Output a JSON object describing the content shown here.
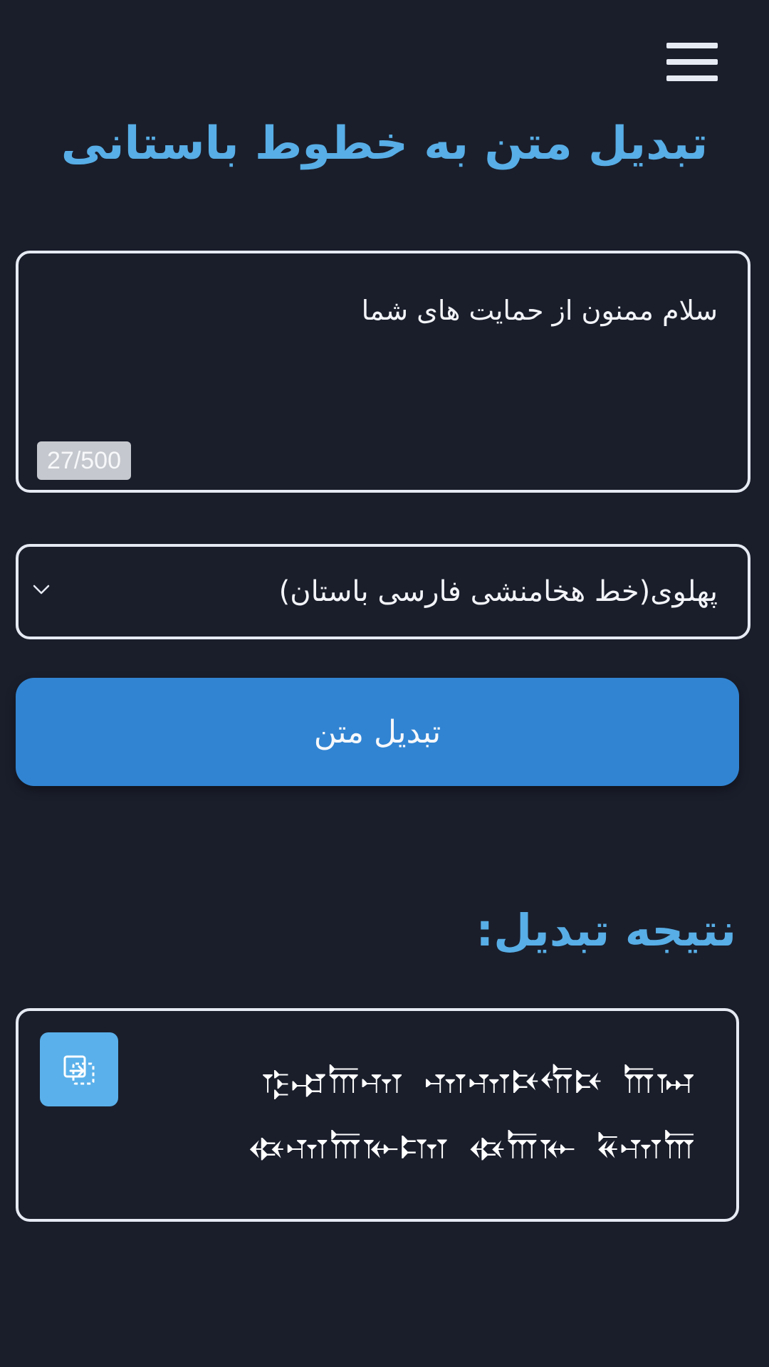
{
  "header": {
    "menu_icon": "hamburger-menu-icon",
    "title": "تبدیل متن به خطوط باستانی"
  },
  "input": {
    "value": "سلام ممنون از حمایت های شما",
    "char_count": "27/500"
  },
  "script_select": {
    "selected": "پهلوی(خط هخامنشی فارسی باستان)",
    "icon": "chevron-down-icon"
  },
  "convert_button": {
    "label": "تبدیل متن"
  },
  "result": {
    "heading": "نتیجه تبدیل:",
    "copy_icon": "copy-icon",
    "text": "𐎿𐎾𐎠𐎶 𐎶𐎶𐎴𐎢𐎴 𐎠𐏀 𐏃𐎶𐎠𐎹𐎫 𐏃𐎠𐎹 𐏁𐎶𐎠"
  },
  "colors": {
    "background": "#1a1e2b",
    "accent": "#58aee6",
    "button": "#3184d2",
    "border": "#e6ebf3"
  }
}
